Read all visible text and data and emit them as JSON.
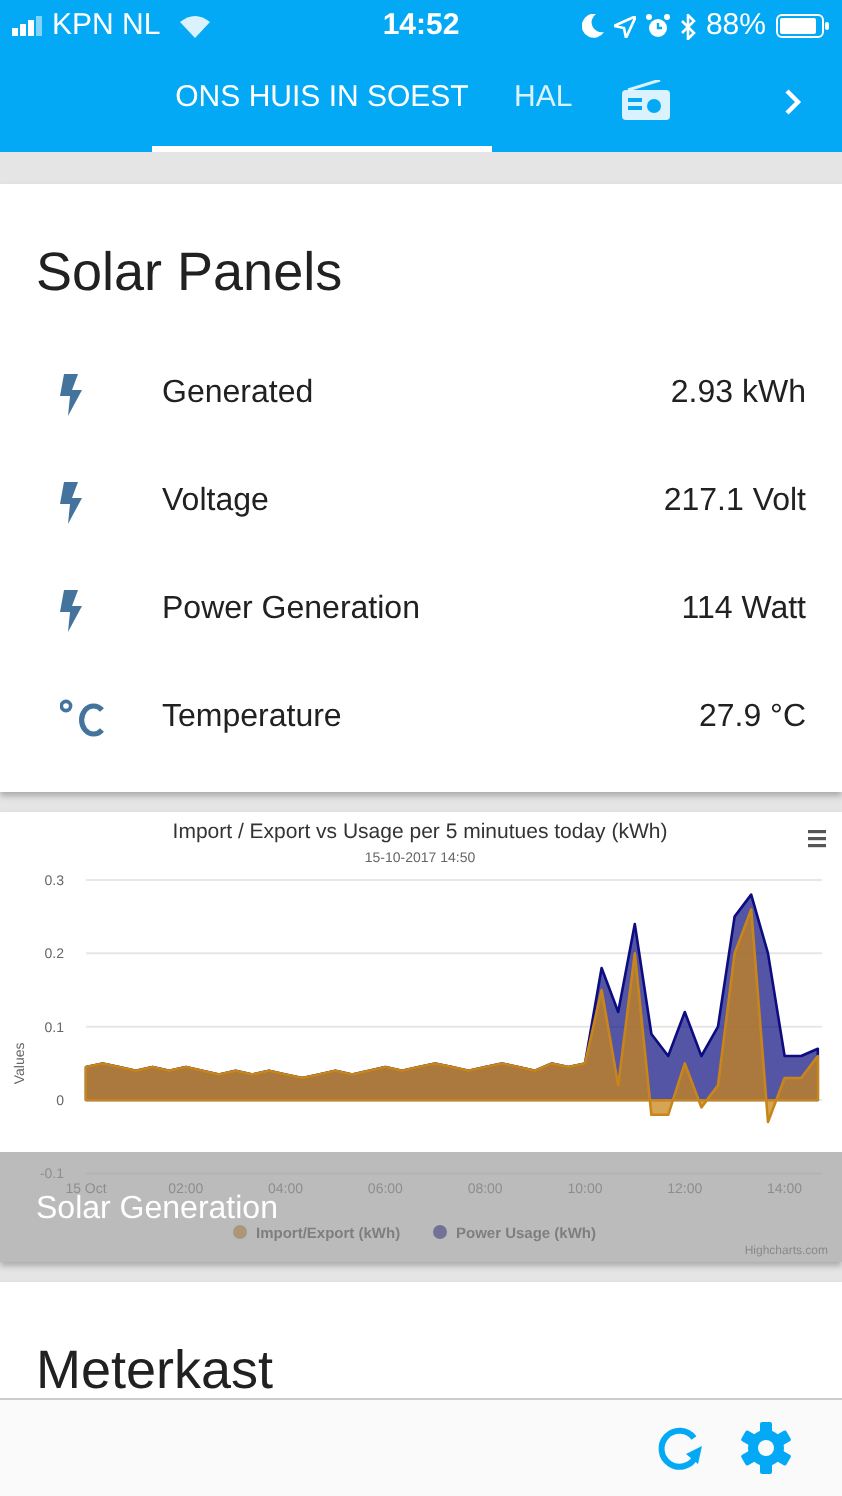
{
  "status_bar": {
    "carrier": "KPN NL",
    "time": "14:52",
    "battery": "88%"
  },
  "tabs": [
    {
      "kind": "text",
      "label": "ONS HUIS IN SOEST",
      "selected": true
    },
    {
      "kind": "text",
      "label": "HAL",
      "selected": false
    },
    {
      "kind": "icon",
      "selected": false
    }
  ],
  "cards": [
    {
      "kind": "entities",
      "title": "Solar Panels",
      "rows": [
        {
          "kind": "bolt",
          "name": "Generated",
          "value": "2.93 kWh"
        },
        {
          "kind": "bolt",
          "name": "Voltage",
          "value": "217.1 Volt"
        },
        {
          "kind": "bolt",
          "name": "Power Generation",
          "value": "114 Watt"
        },
        {
          "kind": "temperature",
          "name": "Temperature",
          "value": "27.9 °C"
        }
      ]
    },
    {
      "kind": "chart",
      "caption": "Solar Generation",
      "credit": "Highcharts.com",
      "chart_data": {
        "type": "area",
        "title": "Import / Export vs Usage per 5 minutues today (kWh)",
        "subtitle": "15-10-2017 14:50",
        "ylabel": "Values",
        "x": [
          0,
          0.333,
          0.667,
          1,
          1.333,
          1.667,
          2,
          2.333,
          2.667,
          3,
          3.333,
          3.667,
          4,
          4.333,
          4.667,
          5,
          5.333,
          5.667,
          6,
          6.333,
          6.667,
          7,
          7.333,
          7.667,
          8,
          8.333,
          8.667,
          9,
          9.333,
          9.667,
          10,
          10.333,
          10.667,
          11,
          11.333,
          11.667,
          12,
          12.333,
          12.667,
          13,
          13.333,
          13.667,
          14,
          14.333,
          14.667
        ],
        "xlim": [
          0,
          14.75
        ],
        "ylim": [
          -0.1,
          0.3
        ],
        "grid": true,
        "legend": true,
        "xticks": [
          {
            "value": 0,
            "label": "15 Oct"
          },
          {
            "value": 2,
            "label": "02:00"
          },
          {
            "value": 4,
            "label": "04:00"
          },
          {
            "value": 6,
            "label": "06:00"
          },
          {
            "value": 8,
            "label": "08:00"
          },
          {
            "value": 10,
            "label": "10:00"
          },
          {
            "value": 12,
            "label": "12:00"
          },
          {
            "value": 14,
            "label": "14:00"
          }
        ],
        "yticks": [
          {
            "value": -0.1,
            "label": "-0.1"
          },
          {
            "value": 0,
            "label": "0"
          },
          {
            "value": 0.1,
            "label": "0.1"
          },
          {
            "value": 0.2,
            "label": "0.2"
          },
          {
            "value": 0.3,
            "label": "0.3"
          }
        ],
        "series": [
          {
            "name": "Import/Export (kWh)",
            "color": "#c8861a",
            "values": [
              0.045,
              0.05,
              0.045,
              0.04,
              0.045,
              0.04,
              0.045,
              0.04,
              0.035,
              0.04,
              0.035,
              0.04,
              0.035,
              0.03,
              0.035,
              0.04,
              0.035,
              0.04,
              0.045,
              0.04,
              0.045,
              0.05,
              0.045,
              0.04,
              0.045,
              0.05,
              0.045,
              0.04,
              0.05,
              0.045,
              0.05,
              0.15,
              0.02,
              0.2,
              -0.02,
              -0.02,
              0.05,
              -0.01,
              0.02,
              0.2,
              0.26,
              -0.03,
              0.03,
              0.03,
              0.06
            ]
          },
          {
            "name": "Power Usage (kWh)",
            "color": "#0d0d80",
            "values": [
              0.045,
              0.05,
              0.045,
              0.04,
              0.045,
              0.04,
              0.045,
              0.04,
              0.035,
              0.04,
              0.035,
              0.04,
              0.035,
              0.03,
              0.035,
              0.04,
              0.035,
              0.04,
              0.045,
              0.04,
              0.045,
              0.05,
              0.045,
              0.04,
              0.045,
              0.05,
              0.045,
              0.04,
              0.05,
              0.045,
              0.05,
              0.18,
              0.12,
              0.24,
              0.09,
              0.06,
              0.12,
              0.06,
              0.1,
              0.25,
              0.28,
              0.2,
              0.06,
              0.06,
              0.07
            ]
          }
        ]
      }
    },
    {
      "kind": "entities",
      "title": "Meterkast"
    }
  ]
}
